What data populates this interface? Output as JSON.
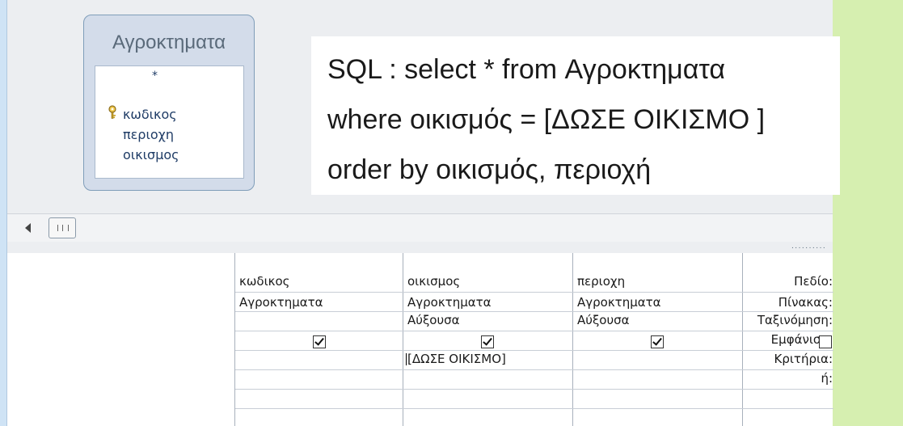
{
  "table": {
    "title": "Αγροκτηματα",
    "fields": [
      "*",
      "κωδικος",
      "περιοχη",
      "οικισμος"
    ]
  },
  "sql": {
    "line1": "SQL :  select * from Αγροκτηματα",
    "line2": "where οικισμός = [ΔΩΣΕ ΟΙΚΙΣΜΟ ]",
    "line3": "order by οικισμός, περιοχή"
  },
  "grid": {
    "row_labels": {
      "field": "Πεδίο:",
      "table": "Πίνακας:",
      "sort": "Ταξινόμηση:",
      "show": "Εμφάνιση:",
      "criteria": "Κριτήρια:",
      "or": "ή:"
    },
    "columns": [
      {
        "field": "κωδικος",
        "table": "Αγροκτηματα",
        "sort": "",
        "show": true,
        "criteria": ""
      },
      {
        "field": "οικισμος",
        "table": "Αγροκτηματα",
        "sort": "Αύξουσα",
        "show": true,
        "criteria": "[ΔΩΣΕ ΟΙΚΙΣΜΟ]"
      },
      {
        "field": "περιοχη",
        "table": "Αγροκτηματα",
        "sort": "Αύξουσα",
        "show": true,
        "criteria": ""
      },
      {
        "field": "",
        "table": "",
        "sort": "",
        "show": false,
        "criteria": ""
      }
    ]
  },
  "icons": {
    "key": "key-icon",
    "scroll_left": "scroll-left-arrow-icon",
    "scroll_thumb": "scroll-thumb-grip-icon"
  },
  "colors": {
    "background_green": "#d6efb0",
    "table_box": "#d3dcea",
    "field_text": "#1f3c66"
  }
}
